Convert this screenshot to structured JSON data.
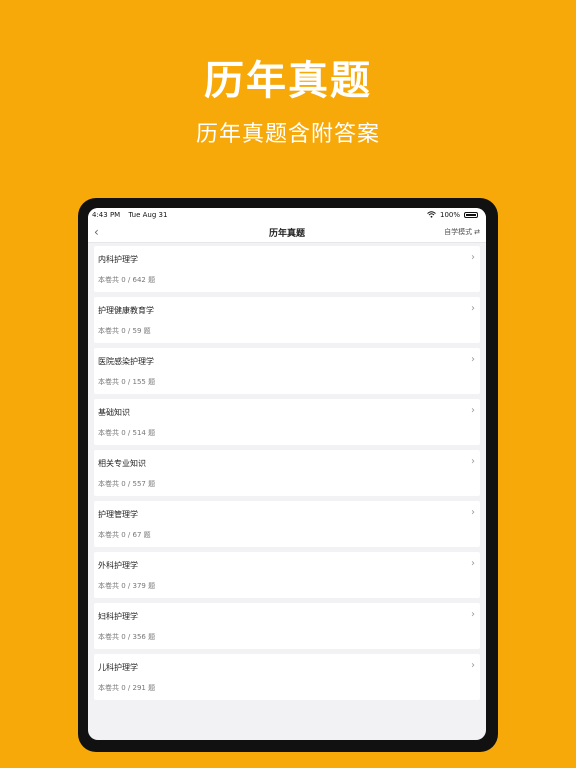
{
  "hero": {
    "title": "历年真题",
    "subtitle": "历年真题含附答案"
  },
  "status_bar": {
    "time": "4:43 PM",
    "date": "Tue Aug 31",
    "battery": "100%"
  },
  "nav": {
    "title": "历年真题",
    "mode": "自学模式",
    "back_icon": "chevron-left-icon",
    "mode_icon": "swap-icon"
  },
  "papers": [
    {
      "title": "内科护理学",
      "count": "本卷共 0 / 642 题"
    },
    {
      "title": "护理健康教育学",
      "count": "本卷共 0 / 59 题"
    },
    {
      "title": "医院感染护理学",
      "count": "本卷共 0 / 155 题"
    },
    {
      "title": "基础知识",
      "count": "本卷共 0 / 514 题"
    },
    {
      "title": "相关专业知识",
      "count": "本卷共 0 / 557 题"
    },
    {
      "title": "护理管理学",
      "count": "本卷共 0 / 67 题"
    },
    {
      "title": "外科护理学",
      "count": "本卷共 0 / 379 题"
    },
    {
      "title": "妇科护理学",
      "count": "本卷共 0 / 356 题"
    },
    {
      "title": "儿科护理学",
      "count": "本卷共 0 / 291 题"
    }
  ],
  "colors": {
    "background": "#F7A90A",
    "device": "#111111",
    "screen": "#F2F2F4",
    "card": "#FFFFFF"
  }
}
